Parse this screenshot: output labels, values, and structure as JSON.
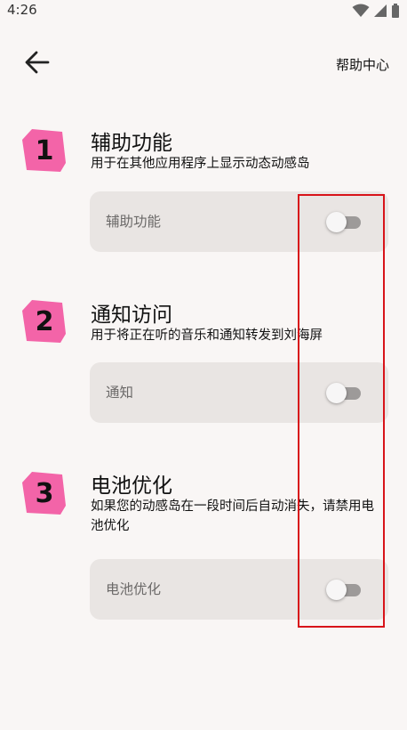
{
  "status_bar": {
    "time": "4:26",
    "icons": [
      "wifi-icon",
      "signal-icon",
      "battery-icon"
    ]
  },
  "header": {
    "back_icon": "arrow-left-icon",
    "help_label": "帮助中心"
  },
  "colors": {
    "background": "#f9f6f5",
    "badge": "#f364a8",
    "card": "#e9e5e3",
    "highlight": "#d8141a"
  },
  "sections": [
    {
      "number": "1",
      "title": "辅助功能",
      "description": "用于在其他应用程序上显示动态动感岛",
      "setting_label": "辅助功能",
      "enabled": false
    },
    {
      "number": "2",
      "title": "通知访问",
      "description": "用于将正在听的音乐和通知转发到刘海屏",
      "setting_label": "通知",
      "enabled": false
    },
    {
      "number": "3",
      "title": "电池优化",
      "description": "如果您的动感岛在一段时间后自动消失，请禁用电池优化",
      "setting_label": "电池优化",
      "enabled": false
    }
  ]
}
